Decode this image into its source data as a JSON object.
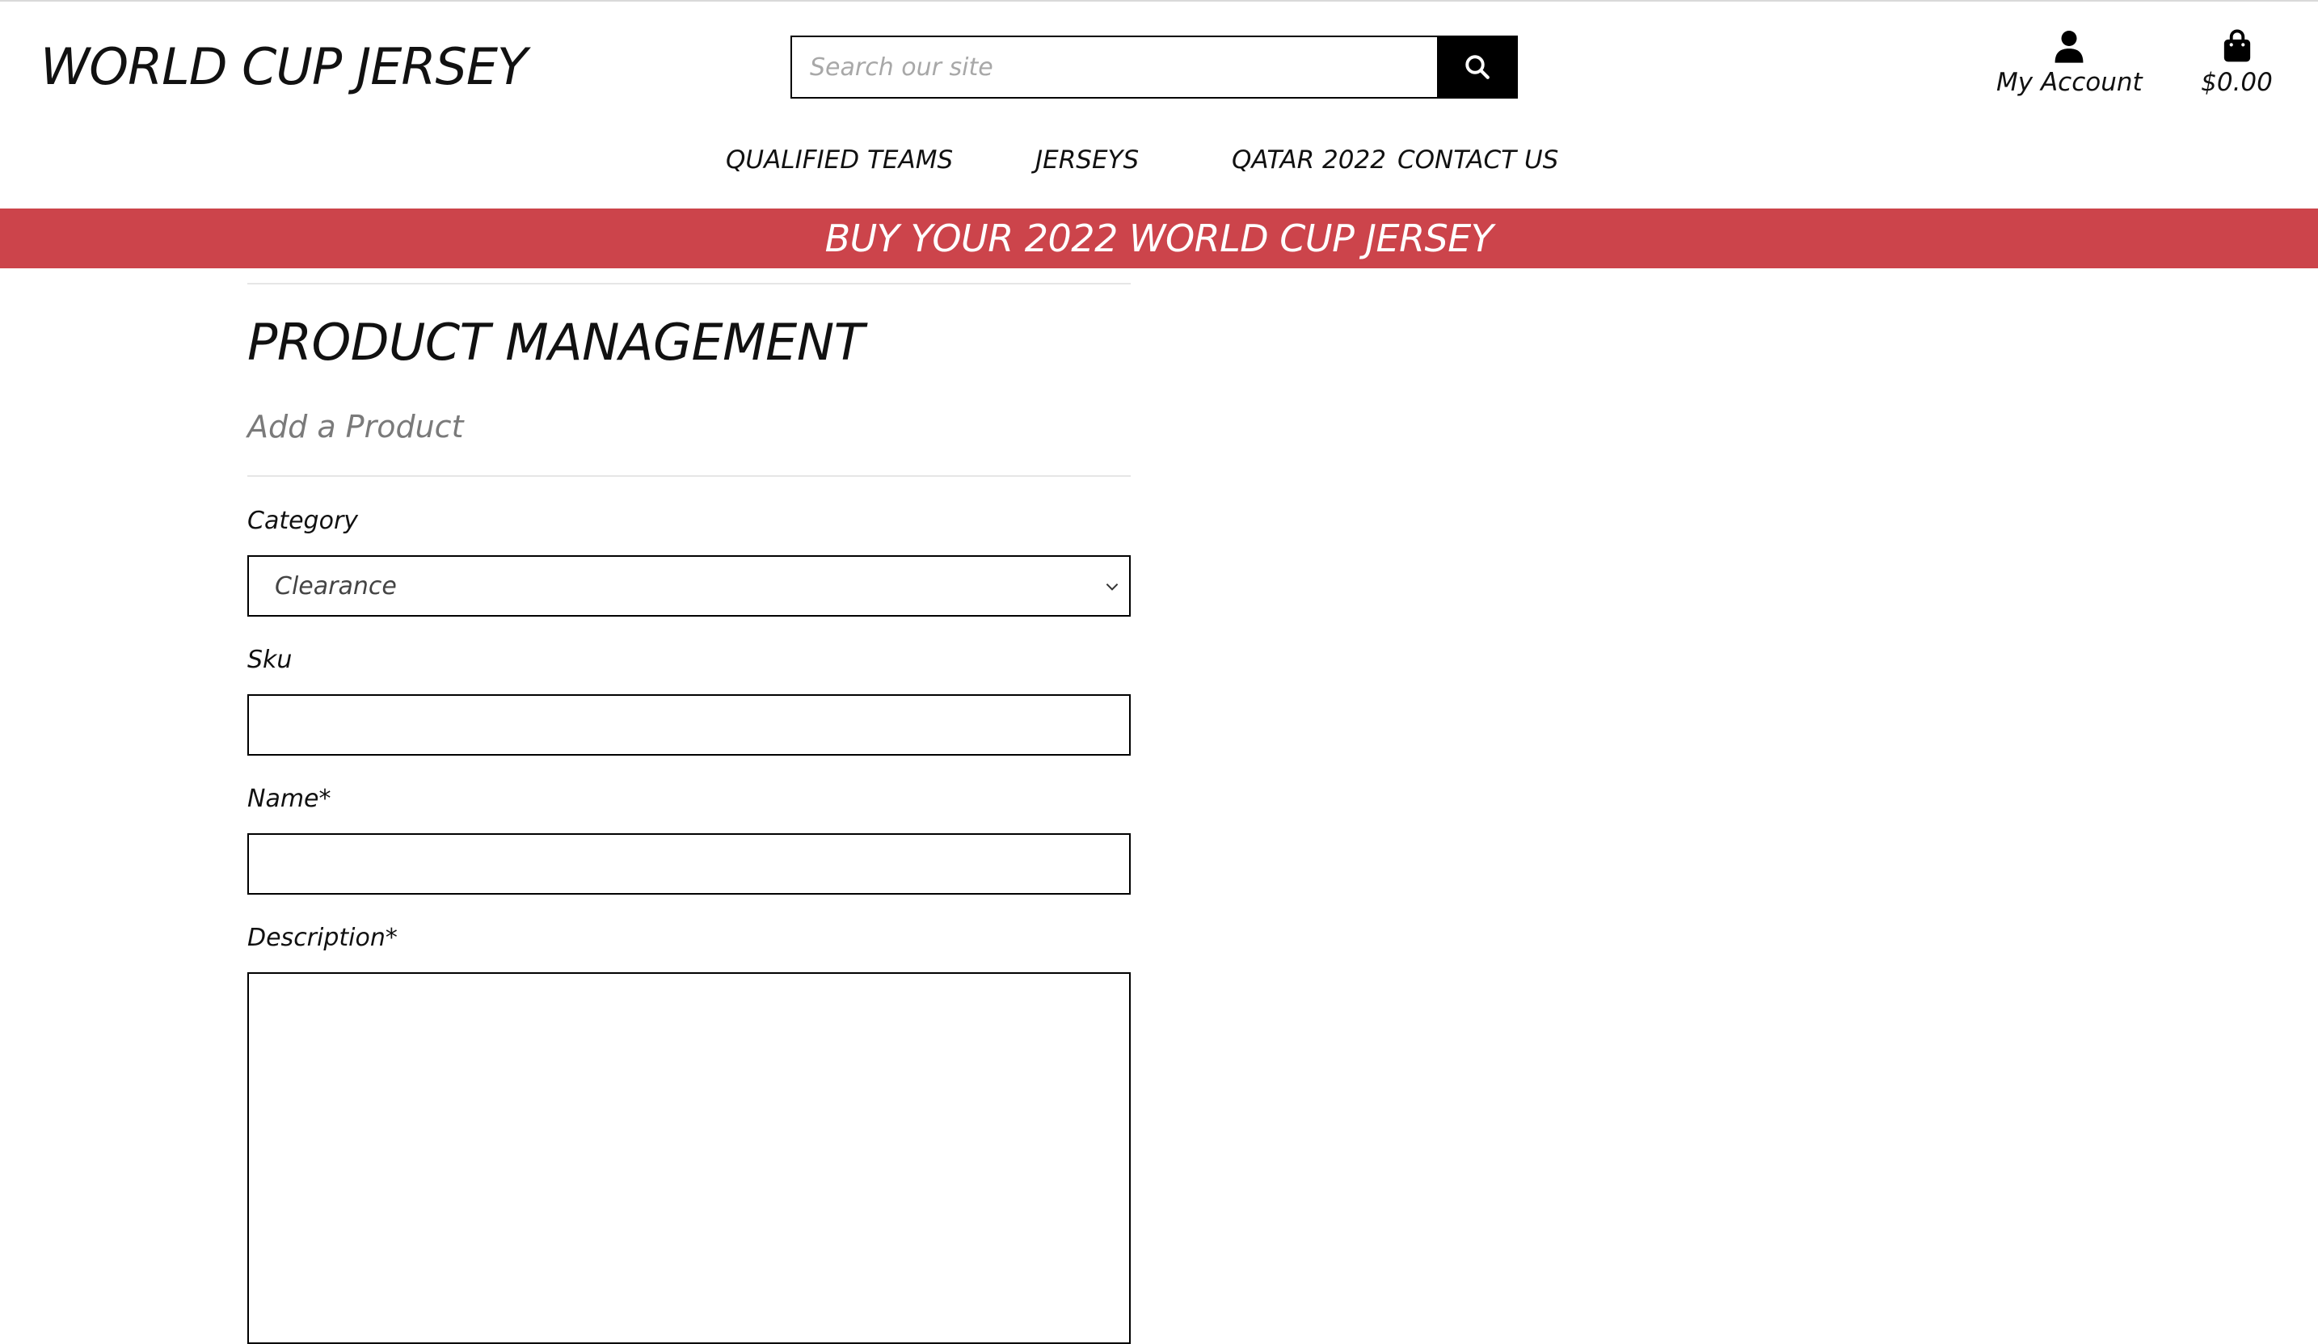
{
  "header": {
    "brand": "WORLD CUP JERSEY",
    "search": {
      "placeholder": "Search our site",
      "value": ""
    },
    "account_label": "My Account",
    "cart_total": "$0.00"
  },
  "nav": {
    "items": [
      {
        "label": "QUALIFIED TEAMS"
      },
      {
        "label": "JERSEYS"
      },
      {
        "label": "QATAR 2022"
      },
      {
        "label": "CONTACT US"
      }
    ]
  },
  "banner": {
    "text": "BUY YOUR 2022 WORLD CUP JERSEY"
  },
  "main": {
    "title": "PRODUCT MANAGEMENT",
    "subtitle": "Add a Product",
    "form": {
      "category": {
        "label": "Category",
        "selected": "Clearance"
      },
      "sku": {
        "label": "Sku",
        "value": ""
      },
      "name": {
        "label": "Name*",
        "value": ""
      },
      "description": {
        "label": "Description*",
        "value": ""
      }
    }
  },
  "icons": {
    "search": "search-icon",
    "account": "user-icon",
    "cart": "shopping-bag-icon",
    "select": "chevron-down-icon"
  },
  "colors": {
    "banner_bg": "#cc444b",
    "banner_text": "#ffffff",
    "search_button_bg": "#000000"
  }
}
